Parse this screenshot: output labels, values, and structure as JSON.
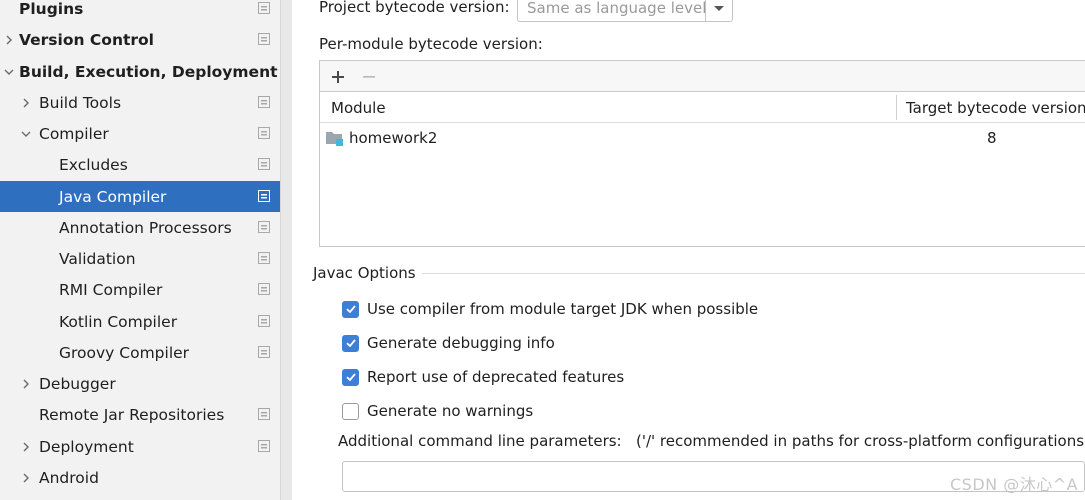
{
  "sidebar": {
    "items": [
      {
        "label": "Plugins",
        "bold": true
      },
      {
        "label": "Version Control",
        "bold": true
      },
      {
        "label": "Build, Execution, Deployment",
        "bold": true
      },
      {
        "label": "Build Tools"
      },
      {
        "label": "Compiler"
      },
      {
        "label": "Excludes"
      },
      {
        "label": "Java Compiler",
        "selected": true
      },
      {
        "label": "Annotation Processors"
      },
      {
        "label": "Validation"
      },
      {
        "label": "RMI Compiler"
      },
      {
        "label": "Kotlin Compiler"
      },
      {
        "label": "Groovy Compiler"
      },
      {
        "label": "Debugger"
      },
      {
        "label": "Remote Jar Repositories"
      },
      {
        "label": "Deployment"
      },
      {
        "label": "Android"
      }
    ]
  },
  "main": {
    "project_bytecode_label": "Project bytecode version:",
    "project_bytecode_value": "Same as language level",
    "per_module_label": "Per-module bytecode version:",
    "table": {
      "columns": [
        "Module",
        "Target bytecode version"
      ],
      "rows": [
        {
          "module": "homework2",
          "target": "8"
        }
      ]
    },
    "javac": {
      "title": "Javac Options",
      "options": [
        {
          "label": "Use compiler from module target JDK when possible",
          "checked": true
        },
        {
          "label": "Generate debugging info",
          "checked": true
        },
        {
          "label": "Report use of deprecated features",
          "checked": true
        },
        {
          "label": "Generate no warnings",
          "checked": false
        }
      ],
      "params_label": "Additional command line parameters:",
      "params_hint": "('/' recommended in paths for cross-platform configurations)",
      "params_value": ""
    }
  },
  "watermark": "CSDN @沐心^A",
  "colors": {
    "selection": "#2f6fc0",
    "checkbox_accent": "#3d7fd6",
    "sidebar_bg": "#f2f2f2",
    "folder_icon": "#9aa7b0",
    "module_badge": "#40b6e0"
  }
}
